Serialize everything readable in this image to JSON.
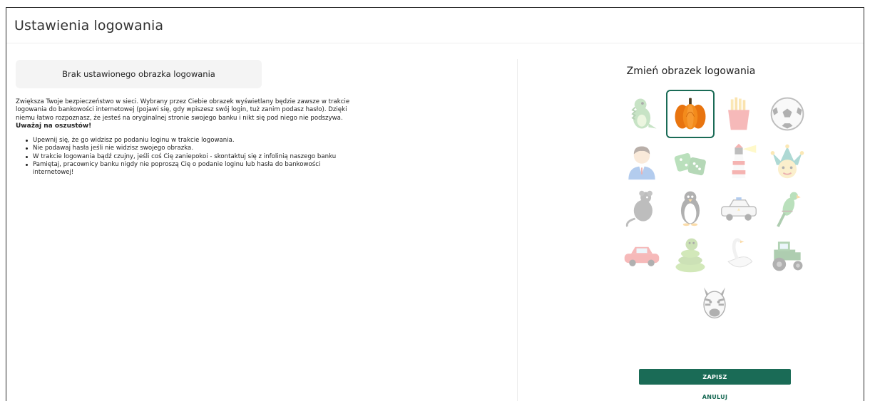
{
  "page": {
    "title": "Ustawienia logowania"
  },
  "left": {
    "no_image_label": "Brak ustawionego obrazka logowania",
    "description": "Zwiększa Twoje bezpieczeństwo w sieci. Wybrany przez Ciebie obrazek wyświetlany będzie zawsze w trakcie logowania do bankowości internetowej (pojawi się, gdy wpiszesz swój login, tuż zanim podasz hasło). Dzięki niemu łatwo rozpoznasz, że jesteś na oryginalnej stronie swojego banku i nikt się pod niego nie podszywa.",
    "warning_title": "Uważaj na oszustów!",
    "warnings": [
      "Upewnij się, że go widzisz po podaniu loginu w trakcie logowania.",
      "Nie podawaj hasła jeśli nie widzisz swojego obrazka.",
      "W trakcie logowania bądź czujny, jeśli coś Cię zaniepokoi - skontaktuj się z infolinią naszego banku",
      "Pamiętaj, pracownicy banku nigdy nie poproszą Cię o podanie loginu lub hasła do bankowości internetowej!"
    ]
  },
  "right": {
    "title": "Zmień obrazek logowania",
    "images": [
      {
        "icon": "dinosaur-icon",
        "selected": false
      },
      {
        "icon": "pumpkin-icon",
        "selected": true
      },
      {
        "icon": "fries-icon",
        "selected": false
      },
      {
        "icon": "soccer-ball-icon",
        "selected": false
      },
      {
        "icon": "businessman-icon",
        "selected": false
      },
      {
        "icon": "dice-icon",
        "selected": false
      },
      {
        "icon": "lighthouse-icon",
        "selected": false
      },
      {
        "icon": "jester-mask-icon",
        "selected": false
      },
      {
        "icon": "rat-icon",
        "selected": false
      },
      {
        "icon": "penguin-icon",
        "selected": false
      },
      {
        "icon": "police-car-icon",
        "selected": false
      },
      {
        "icon": "parrot-icon",
        "selected": false
      },
      {
        "icon": "car-icon",
        "selected": false
      },
      {
        "icon": "snake-icon",
        "selected": false
      },
      {
        "icon": "swan-icon",
        "selected": false
      },
      {
        "icon": "tractor-icon",
        "selected": false
      },
      {
        "icon": "zebra-icon",
        "selected": false
      }
    ],
    "save_label": "ZAPISZ",
    "cancel_label": "ANULUJ"
  },
  "colors": {
    "accent": "#1a6b56",
    "box_bg": "#f4f4f4"
  }
}
